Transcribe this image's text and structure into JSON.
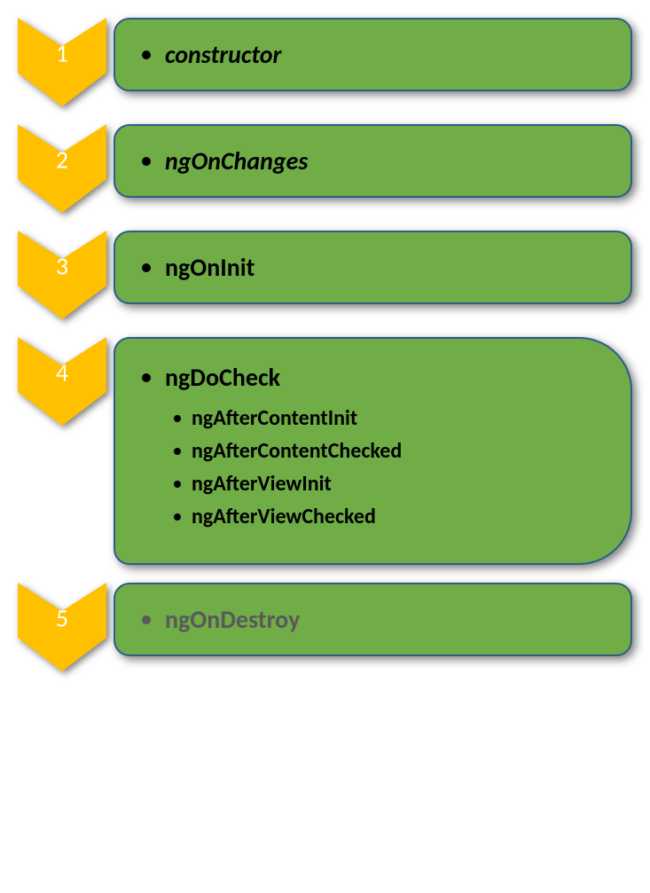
{
  "steps": [
    {
      "num": "1",
      "label": "constructor",
      "italic": true,
      "gray": false,
      "sub": []
    },
    {
      "num": "2",
      "label": "ngOnChanges",
      "italic": true,
      "gray": false,
      "sub": []
    },
    {
      "num": "3",
      "label": "ngOnInit",
      "italic": false,
      "gray": false,
      "sub": []
    },
    {
      "num": "4",
      "label": "ngDoCheck",
      "italic": false,
      "gray": false,
      "sub": [
        "ngAfterContentInit",
        "ngAfterContentChecked",
        "ngAfterViewInit",
        "ngAfterViewChecked"
      ]
    },
    {
      "num": "5",
      "label": "ngOnDestroy",
      "italic": false,
      "gray": true,
      "sub": []
    }
  ],
  "colors": {
    "chevron": "#ffc000",
    "card": "#70ad47",
    "border": "#2e5c8a"
  }
}
